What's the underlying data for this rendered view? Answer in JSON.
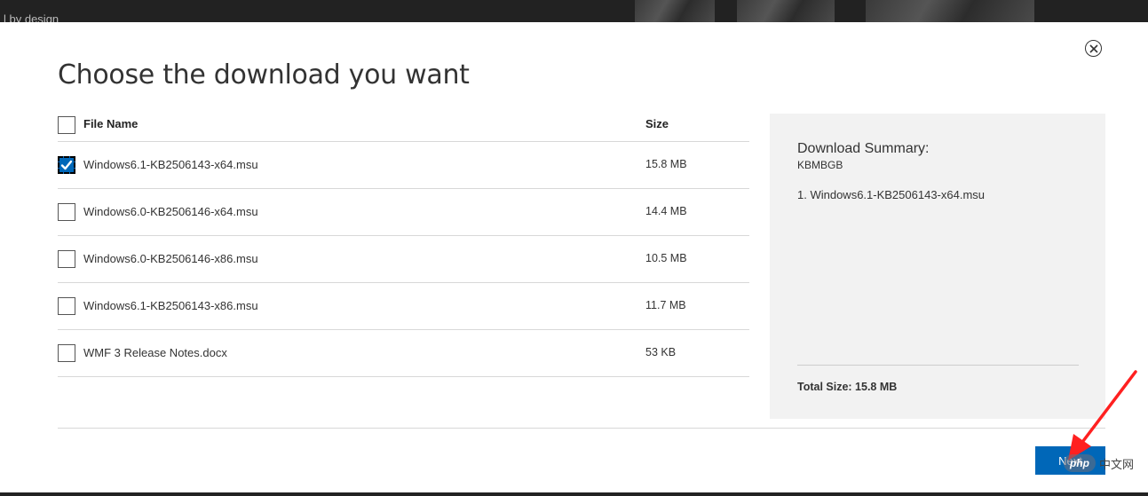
{
  "background": {
    "partial_text": "l by design"
  },
  "dialog": {
    "title": "Choose the download you want",
    "close_icon": "close-circle-icon"
  },
  "table": {
    "columns": {
      "name": "File Name",
      "size": "Size"
    },
    "header_checked": false,
    "rows": [
      {
        "name": "Windows6.1-KB2506143-x64.msu",
        "size": "15.8 MB",
        "checked": true
      },
      {
        "name": "Windows6.0-KB2506146-x64.msu",
        "size": "14.4 MB",
        "checked": false
      },
      {
        "name": "Windows6.0-KB2506146-x86.msu",
        "size": "10.5 MB",
        "checked": false
      },
      {
        "name": "Windows6.1-KB2506143-x86.msu",
        "size": "11.7 MB",
        "checked": false
      },
      {
        "name": "WMF 3 Release Notes.docx",
        "size": "53 KB",
        "checked": false
      }
    ]
  },
  "summary": {
    "title": "Download Summary:",
    "subtitle": "KBMBGB",
    "items": [
      "1. Windows6.1-KB2506143-x64.msu"
    ],
    "total": "Total Size: 15.8 MB"
  },
  "footer": {
    "next_label": "Next"
  },
  "overlay": {
    "watermark_logo": "php",
    "watermark_text": "中文网",
    "arrow_color": "#ff2020"
  },
  "colors": {
    "accent": "#0067b8",
    "summary_bg": "#f2f2f2",
    "topbar": "#222222"
  }
}
